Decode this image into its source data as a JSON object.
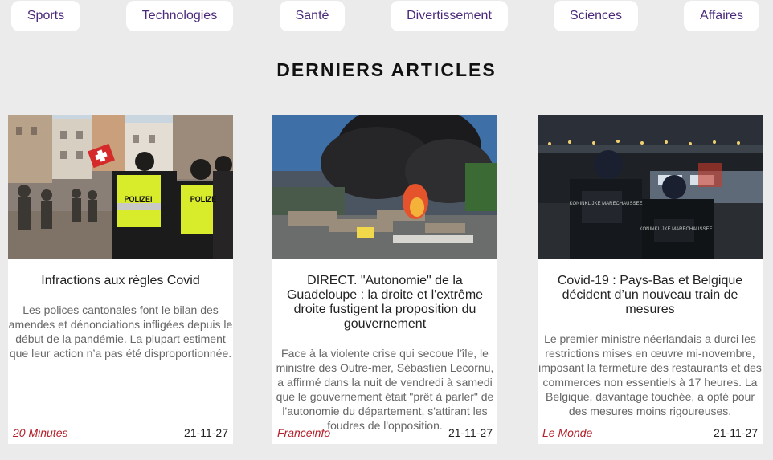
{
  "nav": {
    "items": [
      {
        "label": "Sports"
      },
      {
        "label": "Technologies"
      },
      {
        "label": "Santé"
      },
      {
        "label": "Divertissement"
      },
      {
        "label": "Sciences"
      },
      {
        "label": "Affaires"
      }
    ]
  },
  "section": {
    "title": "DERNIERS ARTICLES"
  },
  "articles": [
    {
      "title": "Infractions aux règles Covid",
      "description": "Les polices cantonales font le bilan des amendes et dénonciations infligées depuis le début de la pandémie. La plupart estiment que leur action n’a pas été disproportionnée.",
      "source": "20 Minutes",
      "date": "21-11-27",
      "image_labels": [
        "POLIZEI",
        "POLIZE"
      ]
    },
    {
      "title": "DIRECT. \"Autonomie\" de la Guadeloupe : la droite et l'extrême droite fustigent la proposition du gouvernement",
      "description": "Face à la violente crise qui secoue l'île, le ministre des Outre-mer, Sébastien Lecornu, a affirmé dans la nuit de vendredi à samedi que le gouvernement était \"prêt à parler\" de l'autonomie du département, s'attirant les foudres de l'opposition.",
      "source": "Franceinfo",
      "date": "21-11-27"
    },
    {
      "title": "Covid-19 : Pays-Bas et Belgique décident d’un nouveau train de mesures",
      "description": "Le premier ministre néerlandais a durci les restrictions mises en œuvre mi-novembre, imposant la fermeture des restaurants et des commerces non essentiels à 17 heures. La Belgique, davantage touchée, a opté pour des mesures moins rigoureuses.",
      "source": "Le Monde",
      "date": "21-11-27",
      "image_labels": [
        "KONINKLIJKE MARECHAUSSEE",
        "KONINKLIJKE MARECHAUSSEE"
      ]
    }
  ],
  "colors": {
    "background": "#ebebeb",
    "nav_text": "#4a2a7a",
    "source_text": "#b3202a"
  }
}
